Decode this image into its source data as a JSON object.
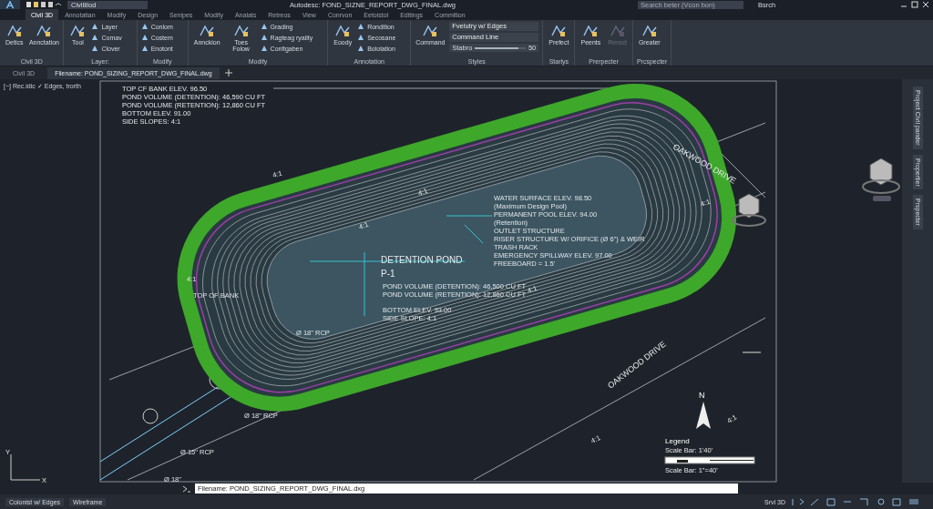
{
  "title_bar": {
    "workspace": "Civilillod",
    "title": "Autodesc: FOND_SIZNE_REPORT_DWG_FINAL.dwg",
    "search_placeholder": "Search beter (Vcon bon)",
    "user": "Bsrch"
  },
  "ribbon_tabs": [
    {
      "label": "Civil 3D",
      "selected": true
    },
    {
      "label": "Annotatian",
      "selected": false
    },
    {
      "label": "Modify",
      "selected": false
    },
    {
      "label": "Design",
      "selected": false
    },
    {
      "label": "Senipes",
      "selected": false
    },
    {
      "label": "Modify",
      "selected": false
    },
    {
      "label": "Analats",
      "selected": false
    },
    {
      "label": "Retreos",
      "selected": false
    },
    {
      "label": "View",
      "selected": false
    },
    {
      "label": "Conrvon",
      "selected": false
    },
    {
      "label": "Eetoistol",
      "selected": false
    },
    {
      "label": "Editings",
      "selected": false
    },
    {
      "label": "Commition",
      "selected": false
    }
  ],
  "ribbon_panels": [
    {
      "title": "Civil 3D",
      "items": [
        {
          "kind": "large",
          "label": "Detics",
          "disabled": false
        },
        {
          "kind": "large",
          "label": "Annctation",
          "disabled": false
        }
      ]
    },
    {
      "title": "Layer:",
      "items": [
        {
          "kind": "large",
          "label": "Tool",
          "disabled": false
        },
        {
          "kind": "small",
          "labels": [
            "Layer",
            "Comav",
            "Clover"
          ]
        }
      ]
    },
    {
      "title": "Modify",
      "items": [
        {
          "kind": "small",
          "labels": [
            "Conlom",
            "Costem",
            "Enotont"
          ]
        }
      ]
    },
    {
      "title": "Modify",
      "items": [
        {
          "kind": "large",
          "label": "Annckion",
          "disabled": false
        },
        {
          "kind": "large",
          "label": "Toes Folow",
          "disabled": false
        },
        {
          "kind": "small",
          "labels": [
            "Grading",
            "Ragteag ryality",
            "Configaben"
          ]
        }
      ]
    },
    {
      "title": "Annotation",
      "items": [
        {
          "kind": "large",
          "label": "Eoody",
          "disabled": false
        },
        {
          "kind": "small",
          "labels": [
            "Rondition",
            "Secosane",
            "Bololation"
          ]
        }
      ]
    },
    {
      "title": "Styles",
      "items": [
        {
          "kind": "large",
          "label": "Command",
          "disabled": false
        },
        {
          "kind": "fields",
          "dropdowns": [
            "Fvelutry w/ Edges",
            "Command Line"
          ],
          "slider": {
            "label": "Stabro",
            "value": "50",
            "level": 0.85
          }
        }
      ]
    },
    {
      "title": "Starlys",
      "items": [
        {
          "kind": "large",
          "label": "Prefect",
          "disabled": false
        }
      ]
    },
    {
      "title": "Prerpecter",
      "items": [
        {
          "kind": "large",
          "label": "Peents",
          "disabled": false
        },
        {
          "kind": "large",
          "label": "Reroct",
          "disabled": true
        }
      ]
    },
    {
      "title": "Prcspecter",
      "items": [
        {
          "kind": "large",
          "label": "Greater",
          "disabled": false
        }
      ]
    }
  ],
  "file_tabs": [
    {
      "label": "Civil 3D",
      "selected": false
    },
    {
      "label": "Filename: POND_SIZING_REPORT_DWG_FINAL.dwg",
      "selected": true
    }
  ],
  "viewport_label": "[−] Rec.idic ✓ Edges, trorth",
  "drawing": {
    "notes_top_left": [
      "TOP CF BANK ELEV. 96.50",
      "POND VOLUME (DETENTION): 46,590 CU FT",
      "POND VOLUME (RETENTION): 12,860 CU FT",
      "BOTTOM ELEV. 91.00",
      "SIDE SLOPES: 4:1"
    ],
    "pond_name": "DETENTION POND",
    "pond_id": "P-1",
    "pond_notes": [
      "POND VOLUME (DETENTION): 46,500 CU FT",
      "POND VOLUME (RETENTION): 12,860 CU FT",
      "BOTTOM ELEV. 93.00",
      "SIDE SLOPE: 4:1"
    ],
    "outlet_notes": [
      "WATER SURFACE ELEV. 98.50",
      "(Maximum Design Pool)",
      "PERMANENT POOL ELEV. 94.00",
      "(Retention)",
      "OUTLET STRUCTURE",
      "RISER STRUCTURE W/ ORIFICE (Ø 6\") & WEIR",
      "TRASH RACK",
      "EMERGENCY SPILLWAY ELEV. 97.00",
      "FREEBOARD = 1.5'"
    ],
    "road_labels": [
      "OAKWOOD DRIVE",
      "OAKWOOD DRIVE"
    ],
    "bank_label": "TOP OF BANK",
    "pipe_labels": [
      "Ø 15\" RCP",
      "Ø 18\"",
      "Ø 18\" RCP",
      "Ø 18\" RCP"
    ],
    "slope_labels": [
      "4:1",
      "4:1",
      "4:1",
      "4:1",
      "4:1",
      "4:1",
      "4:1",
      "4:1"
    ]
  },
  "legend": {
    "north": "N",
    "title": "Legend",
    "scale_text": "Scale Bar: 1'40'",
    "scale_caption": "Scale Bar: 1\"=40'"
  },
  "ucs": {
    "x": "X",
    "y": "Y"
  },
  "side_panel_tabs": [
    "Project Civil pander",
    "Propertier",
    "Prspecter"
  ],
  "command_line": {
    "value": "Filename: POND_SIZING_REPORT_DWG_FINAL.dxg"
  },
  "status_bar": {
    "left": [
      "Colonist w/ Edges",
      "Wireframe"
    ],
    "space": "Srvl 3D"
  }
}
